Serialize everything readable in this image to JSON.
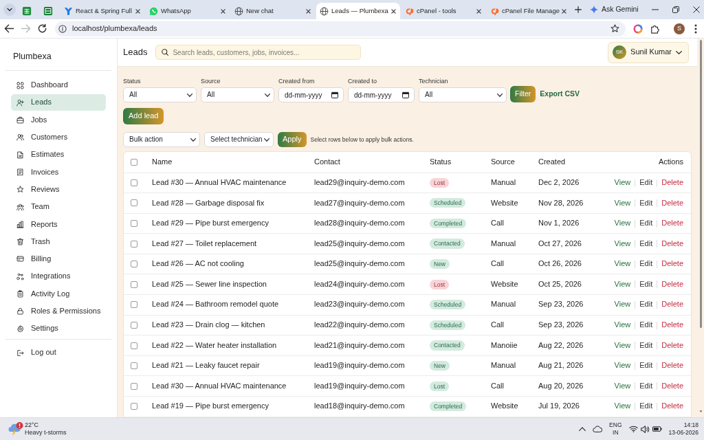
{
  "browser": {
    "tabs": [
      {
        "kind": "pinned",
        "selected": false
      },
      {
        "kind": "pinned",
        "selected": false
      },
      {
        "kind": "page",
        "title": "React & Spring Full",
        "selected": false
      },
      {
        "kind": "page",
        "title": "WhatsApp",
        "selected": false
      },
      {
        "kind": "page",
        "title": "New chat",
        "selected": false
      },
      {
        "kind": "page",
        "title": "Leads — Plumbexa",
        "selected": true
      },
      {
        "kind": "page",
        "title": "cPanel - tools",
        "selected": false
      },
      {
        "kind": "page",
        "title": "cPanel File Manage",
        "selected": false
      }
    ],
    "gemini_button": "Ask Gemini",
    "nav_buttons": [
      {
        "kind": "back",
        "disabled": false
      },
      {
        "kind": "forward",
        "disabled": true
      },
      {
        "kind": "reload",
        "disabled": false
      }
    ],
    "url": "localhost/plumbexa/leads",
    "profile_initial": "S"
  },
  "app": {
    "brand": "Plumbexa",
    "nav": [
      {
        "label": "Dashboard",
        "selected": false
      },
      {
        "label": "Leads",
        "selected": true
      },
      {
        "label": "Jobs",
        "selected": false
      },
      {
        "label": "Customers",
        "selected": false
      },
      {
        "label": "Estimates",
        "selected": false
      },
      {
        "label": "Invoices",
        "selected": false
      },
      {
        "label": "Reviews",
        "selected": false
      },
      {
        "label": "Team",
        "selected": false
      },
      {
        "label": "Reports",
        "selected": false
      },
      {
        "label": "Trash",
        "selected": false
      },
      {
        "label": "Billing",
        "selected": false
      },
      {
        "label": "Integrations",
        "selected": false
      },
      {
        "label": "Activity Log",
        "selected": false
      },
      {
        "label": "Roles & Permissions",
        "selected": false
      },
      {
        "label": "Settings",
        "selected": false
      }
    ],
    "logout": "Log out",
    "page_title": "Leads",
    "search": {
      "placeholder": "Search leads, customers, jobs, invoices..."
    },
    "user": {
      "initials": "SK",
      "name": "Sunil Kumar"
    },
    "filters": [
      {
        "kind": "select",
        "label": "Status",
        "value": "All"
      },
      {
        "kind": "select",
        "label": "Source",
        "value": "All"
      },
      {
        "kind": "date",
        "label": "Created from",
        "placeholder": "dd-mm-yyyy"
      },
      {
        "kind": "date",
        "label": "Created to",
        "placeholder": "dd-mm-yyyy"
      },
      {
        "kind": "select",
        "label": "Technician",
        "value": "All"
      }
    ],
    "filter_button": "Filter",
    "export_link": "Export CSV",
    "add_button": "Add lead",
    "bulk": {
      "action": "Bulk action",
      "technician": "Select technician",
      "apply_button": "Apply",
      "hint": "Select rows below to apply bulk actions."
    },
    "table": {
      "select_all": false,
      "columns": [
        "Name",
        "Contact",
        "Status",
        "Source",
        "Created",
        "Actions"
      ],
      "rows": [
        {
          "checked": false,
          "name": "Lead #30 — Annual HVAC maintenance",
          "contact": "lead29@inquiry-demo.com",
          "status": {
            "label": "Lost",
            "color": "#f7d4d7"
          },
          "source": "Manual",
          "created": "Dec 2, 2026",
          "actions": [
            "View",
            "Edit",
            "Delete"
          ]
        },
        {
          "checked": false,
          "name": "Lead #28 — Garbage disposal fix",
          "contact": "lead27@inquiry-demo.com",
          "status": {
            "label": "Scheduled",
            "color": "#d3eadf"
          },
          "source": "Website",
          "created": "Nov 28, 2026",
          "actions": [
            "View",
            "Edit",
            "Delete"
          ]
        },
        {
          "checked": false,
          "name": "Lead #29 — Pipe burst emergency",
          "contact": "lead28@inquiry-demo.com",
          "status": {
            "label": "Completed",
            "color": "#d3eadf"
          },
          "source": "Call",
          "created": "Nov 1, 2026",
          "actions": [
            "View",
            "Edit",
            "Delete"
          ]
        },
        {
          "checked": false,
          "name": "Lead #27 — Toilet replacement",
          "contact": "lead25@inquiry-demo.com",
          "status": {
            "label": "Contacted",
            "color": "#d3eadf"
          },
          "source": "Manual",
          "created": "Oct 27, 2026",
          "actions": [
            "View",
            "Edit",
            "Delete"
          ]
        },
        {
          "checked": false,
          "name": "Lead #26 — AC not cooling",
          "contact": "lead25@inquiry-demo.com",
          "status": {
            "label": "New",
            "color": "#d3eadf"
          },
          "source": "Call",
          "created": "Oct 26, 2026",
          "actions": [
            "View",
            "Edit",
            "Delete"
          ]
        },
        {
          "checked": false,
          "name": "Lead #25 — Sewer line inspection",
          "contact": "lead24@inquiry-demo.com",
          "status": {
            "label": "Lost",
            "color": "#f7d4d7"
          },
          "source": "Website",
          "created": "Oct 25, 2026",
          "actions": [
            "View",
            "Edit",
            "Delete"
          ]
        },
        {
          "checked": false,
          "name": "Lead #24 — Bathroom remodel quote",
          "contact": "lead23@inquiry-demo.com",
          "status": {
            "label": "Scheduled",
            "color": "#d3eadf"
          },
          "source": "Manual",
          "created": "Sep 23, 2026",
          "actions": [
            "View",
            "Edit",
            "Delete"
          ]
        },
        {
          "checked": false,
          "name": "Lead #23 — Drain clog — kitchen",
          "contact": "lead22@inquiry-demo.com",
          "status": {
            "label": "Scheduled",
            "color": "#d3eadf"
          },
          "source": "Call",
          "created": "Sep 23, 2026",
          "actions": [
            "View",
            "Edit",
            "Delete"
          ]
        },
        {
          "checked": false,
          "name": "Lead #22 — Water heater installation",
          "contact": "lead21@inquiry-demo.com",
          "status": {
            "label": "Contacted",
            "color": "#d3eadf"
          },
          "source": "Manoiie",
          "created": "Aug 22, 2026",
          "actions": [
            "View",
            "Edit",
            "Delete"
          ]
        },
        {
          "checked": false,
          "name": "Lead #21 — Leaky faucet repair",
          "contact": "lead19@inquiry-demo.com",
          "status": {
            "label": "New",
            "color": "#d3eadf"
          },
          "source": "Manual",
          "created": "Aug 21, 2026",
          "actions": [
            "View",
            "Edit",
            "Delete"
          ]
        },
        {
          "checked": false,
          "name": "Lead #30 — Annual HVAC maintenance",
          "contact": "lead19@inquiry-demo.com",
          "status": {
            "label": "Lost",
            "color": "#d3eadf"
          },
          "source": "Call",
          "created": "Aug 20, 2026",
          "actions": [
            "View",
            "Edit",
            "Delete"
          ]
        },
        {
          "checked": false,
          "name": "Lead #19 — Pipe burst emergency",
          "contact": "lead18@inquiry-demo.com",
          "status": {
            "label": "Completed",
            "color": "#d3eadf"
          },
          "source": "Website",
          "created": "Jul 19, 2026",
          "actions": [
            "View",
            "Edit",
            "Delete"
          ]
        }
      ]
    }
  },
  "taskbar": {
    "weather": {
      "temperature": "22°C",
      "condition": "Heavy t-storms"
    },
    "language": {
      "code": "ENG",
      "region": "IN"
    },
    "clock": {
      "time": "14:18",
      "date": "13-06-2026"
    }
  }
}
